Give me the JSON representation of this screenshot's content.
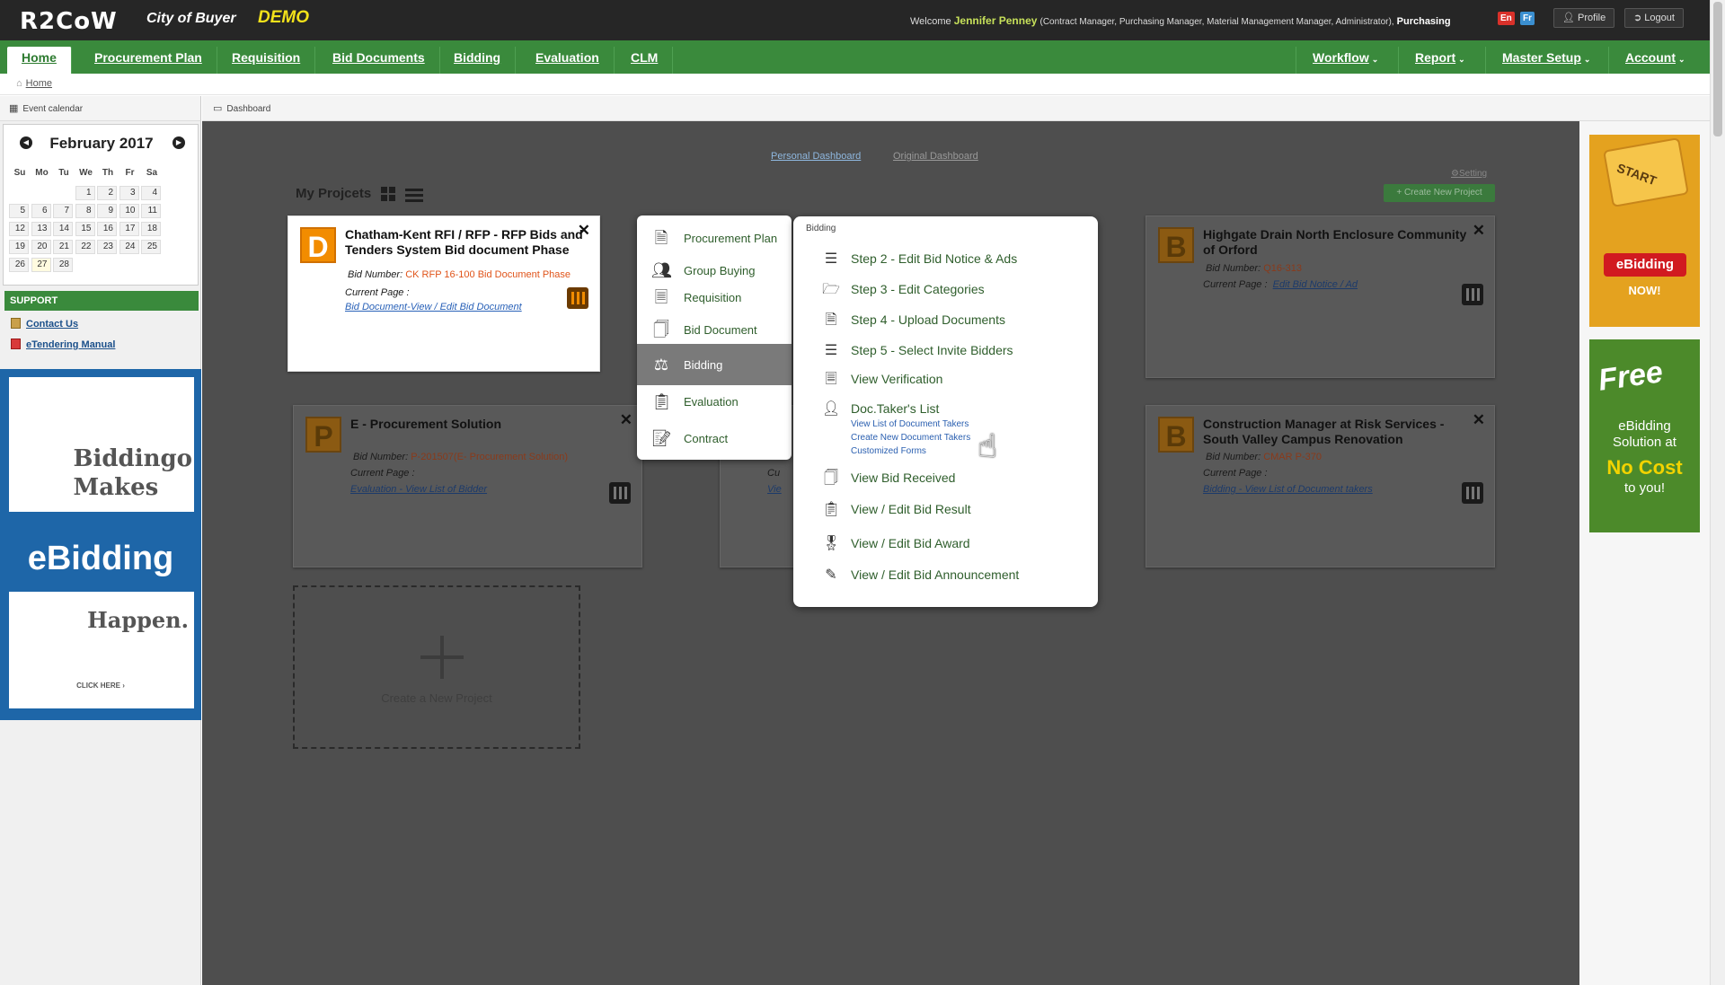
{
  "app": {
    "logo": "R2CoW",
    "org": "City of Buyer",
    "demo": "DEMO",
    "welcome_prefix": "Welcome",
    "user_name": "Jennifer Penney",
    "user_roles": "(Contract Manager, Purchasing Manager, Material Management Manager, Administrator),",
    "user_dept": "Purchasing",
    "lang_en": "En",
    "lang_fr": "Fr",
    "profile": "Profile",
    "logout": "Logout"
  },
  "nav": {
    "left": [
      "Home",
      "Procurement Plan",
      "Requisition",
      "Bid Documents",
      "Bidding",
      "Evaluation",
      "CLM"
    ],
    "right": [
      "Workflow",
      "Report",
      "Master Setup",
      "Account"
    ]
  },
  "breadcrumb": {
    "home": "Home"
  },
  "panels": {
    "left": "Event calendar",
    "right": "Dashboard"
  },
  "calendar": {
    "month": "February 2017",
    "dow": [
      "Su",
      "Mo",
      "Tu",
      "We",
      "Th",
      "Fr",
      "Sa"
    ],
    "days": [
      "1",
      "2",
      "3",
      "4",
      "5",
      "6",
      "7",
      "8",
      "9",
      "10",
      "11",
      "12",
      "13",
      "14",
      "15",
      "16",
      "17",
      "18",
      "19",
      "20",
      "21",
      "22",
      "23",
      "24",
      "25",
      "26",
      "27",
      "28"
    ],
    "today": "27"
  },
  "support": {
    "heading": "SUPPORT",
    "contact": "Contact Us",
    "manual": "eTendering Manual"
  },
  "ad_left": {
    "line1": "Biddingo",
    "line2": "Makes",
    "line3": "eBidding",
    "line4": "Happen.",
    "cta": "CLICK HERE ›"
  },
  "dashboard": {
    "tab_personal": "Personal Dashboard",
    "tab_original": "Original Dashboard",
    "settings": "Setting",
    "create": "Create New Project",
    "my_projects": "My Projcets",
    "new_project": "Create a New Project",
    "bid_number_label": "Bid Number:",
    "current_page_label": "Current Page :",
    "projects": [
      {
        "letter": "D",
        "title": "Chatham-Kent RFI / RFP - RFP Bids and Tenders System Bid document Phase",
        "bid_number": "CK RFP 16-100 Bid Document Phase",
        "current_page": "Bid Document-View / Edit Bid Document"
      },
      {
        "letter": "B",
        "title": "Highgate Drain North Enclosure Community of Orford",
        "bid_number": "Q16-313",
        "current_page": "Edit Bid Notice / Ad"
      },
      {
        "letter": "P",
        "title": "E - Procurement Solution",
        "bid_number": "P-201507(E- Procurement Solution)",
        "current_page": "Evaluation - View List of Bidder"
      },
      {
        "letter": "B",
        "title": "Construction Manager at Risk Services - South Valley Campus Renovation",
        "bid_number": "CMAR P-370",
        "current_page": "Bidding - View List of Document takers"
      }
    ],
    "hidden_card_fragments": [
      "Vie",
      "Cu"
    ]
  },
  "menu1": {
    "items": [
      "Procurement Plan",
      "Group Buying",
      "Requisition",
      "Bid Document",
      "Bidding",
      "Evaluation",
      "Contract"
    ],
    "active": "Bidding"
  },
  "menu2": {
    "heading": "Bidding",
    "items": [
      "Step 2 - Edit Bid Notice & Ads",
      "Step 3 - Edit Categories",
      "Step 4 - Upload Documents",
      "Step 5 - Select Invite Bidders",
      "View Verification",
      "Doc.Taker's List",
      "View Bid Received",
      "View / Edit Bid Result",
      "View / Edit Bid Award",
      "View / Edit Bid Announcement"
    ],
    "doc_taker_sub": [
      "View List of Document Takers",
      "Create New Document Takers",
      "Customized Forms"
    ]
  },
  "ad_right": {
    "start": "START",
    "ebidding": "eBidding",
    "now": "NOW!",
    "free": "Free",
    "line1": "eBidding",
    "line2": "Solution at",
    "nocost": "No Cost",
    "toyou": "to you!"
  },
  "colors": {
    "nav_green": "#3a8a3c",
    "top_dark": "#262626",
    "accent_orange": "#f28c00",
    "menu_text_green": "#2f5e2c"
  }
}
